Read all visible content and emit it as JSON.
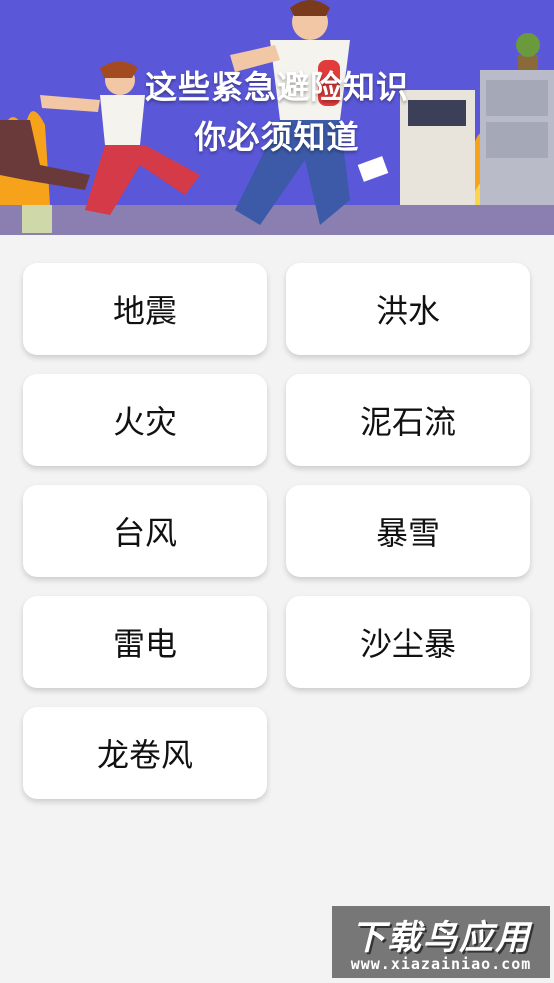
{
  "banner": {
    "title_line1": "这些紧急避险知识",
    "title_line2": "你必须知道"
  },
  "disasters": {
    "earthquake": "地震",
    "flood": "洪水",
    "fire": "火灾",
    "mudslide": "泥石流",
    "typhoon": "台风",
    "blizzard": "暴雪",
    "thunder": "雷电",
    "sandstorm": "沙尘暴",
    "tornado": "龙卷风"
  },
  "watermark": {
    "brand": "下载鸟应用",
    "url": "www.xiazainiao.com"
  },
  "colors": {
    "banner_bg": "#5a58d8",
    "page_bg": "#f3f3f3",
    "card_bg": "#ffffff"
  }
}
